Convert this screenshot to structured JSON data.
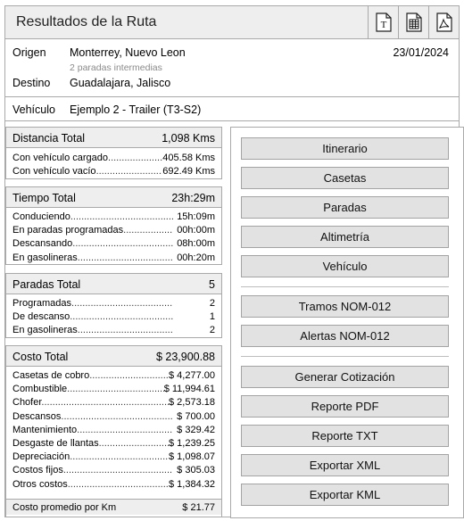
{
  "header": {
    "title": "Resultados de la Ruta"
  },
  "route": {
    "origin_label": "Origen",
    "origin": "Monterrey, Nuevo Leon",
    "stops_note": "2 paradas intermedias",
    "destination_label": "Destino",
    "destination": "Guadalajara, Jalisco",
    "date": "23/01/2024",
    "vehicle_label": "Vehículo",
    "vehicle": "Ejemplo 2 - Trailer (T3-S2)"
  },
  "distance": {
    "title": "Distancia Total",
    "value": "1,098 Kms",
    "rows": [
      {
        "label": "Con vehículo cargado",
        "value": "405.58 Kms"
      },
      {
        "label": "Con vehículo vacío",
        "value": "692.49 Kms"
      }
    ]
  },
  "time": {
    "title": "Tiempo Total",
    "value": "23h:29m",
    "rows": [
      {
        "label": "Conduciendo",
        "value": "15h:09m"
      },
      {
        "label": "En paradas programadas",
        "value": "00h:00m"
      },
      {
        "label": "Descansando",
        "value": "08h:00m"
      },
      {
        "label": "En gasolineras",
        "value": "00h:20m"
      }
    ]
  },
  "stops": {
    "title": "Paradas Total",
    "value": "5",
    "rows": [
      {
        "label": "Programadas",
        "value": "2"
      },
      {
        "label": "De descanso",
        "value": "1"
      },
      {
        "label": "En gasolineras",
        "value": "2"
      }
    ]
  },
  "cost": {
    "title": "Costo Total",
    "value": "$ 23,900.88",
    "rows": [
      {
        "label": "Casetas de cobro",
        "value": "$ 4,277.00"
      },
      {
        "label": "Combustible",
        "value": "$ 11,994.61"
      },
      {
        "label": "Chofer",
        "value": "$ 2,573.18"
      },
      {
        "label": "Descansos",
        "value": "$ 700.00"
      },
      {
        "label": "Mantenimiento",
        "value": "$ 329.42"
      },
      {
        "label": "Desgaste de llantas",
        "value": "$ 1,239.25"
      },
      {
        "label": "Depreciación",
        "value": "$ 1,098.07"
      },
      {
        "label": "Costos fijos",
        "value": "$ 305.03"
      },
      {
        "label": "Otros costos",
        "value": "$ 1,384.32"
      }
    ],
    "footer_label": "Costo promedio por Km",
    "footer_value": "$ 21.77"
  },
  "buttons": {
    "itinerary": "Itinerario",
    "tolls": "Casetas",
    "stops": "Paradas",
    "altimetry": "Altimetría",
    "vehicle": "Vehículo",
    "segments_nom": "Tramos NOM-012",
    "alerts_nom": "Alertas NOM-012",
    "quote": "Generar Cotización",
    "pdf": "Reporte PDF",
    "txt": "Reporte TXT",
    "xml": "Exportar XML",
    "kml": "Exportar KML"
  },
  "icons": [
    "text-file-icon",
    "spreadsheet-icon",
    "pdf-icon"
  ]
}
